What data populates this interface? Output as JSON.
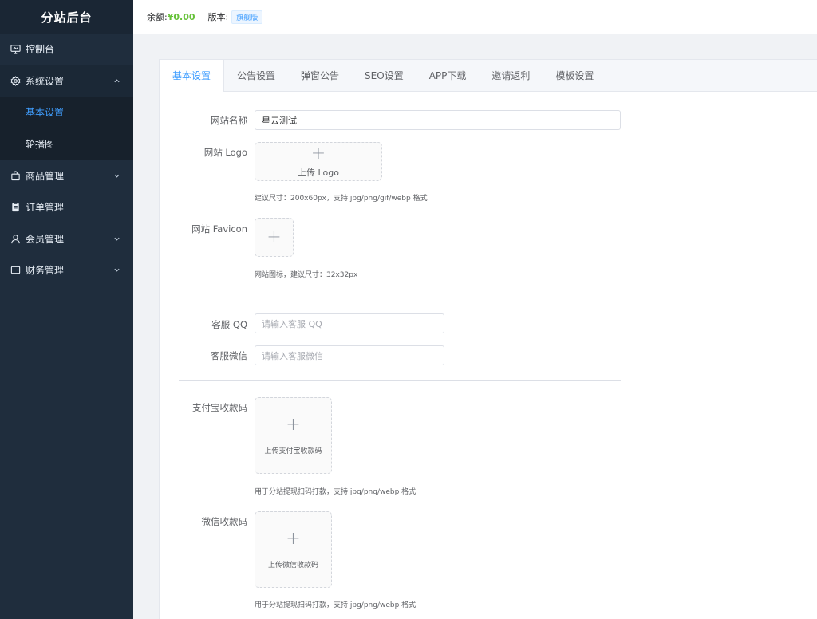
{
  "sidebar": {
    "brand": "分站后台",
    "menu": [
      {
        "label": "控制台",
        "icon": "dashboard-icon"
      },
      {
        "label": "系统设置",
        "icon": "gear-icon",
        "expanded": true,
        "children": [
          {
            "label": "基本设置",
            "active": true
          },
          {
            "label": "轮播图",
            "active": false
          }
        ]
      },
      {
        "label": "商品管理",
        "icon": "bag-icon",
        "expanded": false
      },
      {
        "label": "订单管理",
        "icon": "clipboard-icon"
      },
      {
        "label": "会员管理",
        "icon": "user-icon",
        "expanded": false
      },
      {
        "label": "财务管理",
        "icon": "wallet-icon",
        "expanded": false
      }
    ]
  },
  "header": {
    "balance_label": "余额:",
    "balance_value": "¥0.00",
    "version_label": "版本:",
    "version_tag": "旗舰版"
  },
  "tabs": [
    "基本设置",
    "公告设置",
    "弹窗公告",
    "SEO设置",
    "APP下载",
    "邀请返利",
    "模板设置"
  ],
  "active_tab": "基本设置",
  "form": {
    "site_name_label": "网站名称",
    "site_name_value": "星云测试",
    "site_logo_label": "网站 Logo",
    "logo_upload_text": "上传 Logo",
    "logo_hint": "建议尺寸：200x60px，支持 jpg/png/gif/webp 格式",
    "favicon_label": "网站 Favicon",
    "favicon_hint": "网站图标，建议尺寸：32x32px",
    "qq_label": "客服 QQ",
    "qq_placeholder": "请输入客服 QQ",
    "wechat_label": "客服微信",
    "wechat_placeholder": "请输入客服微信",
    "alipay_label": "支付宝收款码",
    "alipay_upload_text": "上传支付宝收款码",
    "alipay_hint": "用于分站提现扫码打款，支持 jpg/png/webp 格式",
    "wxpay_label": "微信收款码",
    "wxpay_upload_text": "上传微信收款码",
    "wxpay_hint": "用于分站提现扫码打款，支持 jpg/png/webp 格式"
  },
  "colors": {
    "sidebar_bg": "#1f2d3d",
    "accent": "#409eff",
    "balance": "#67c23a"
  }
}
